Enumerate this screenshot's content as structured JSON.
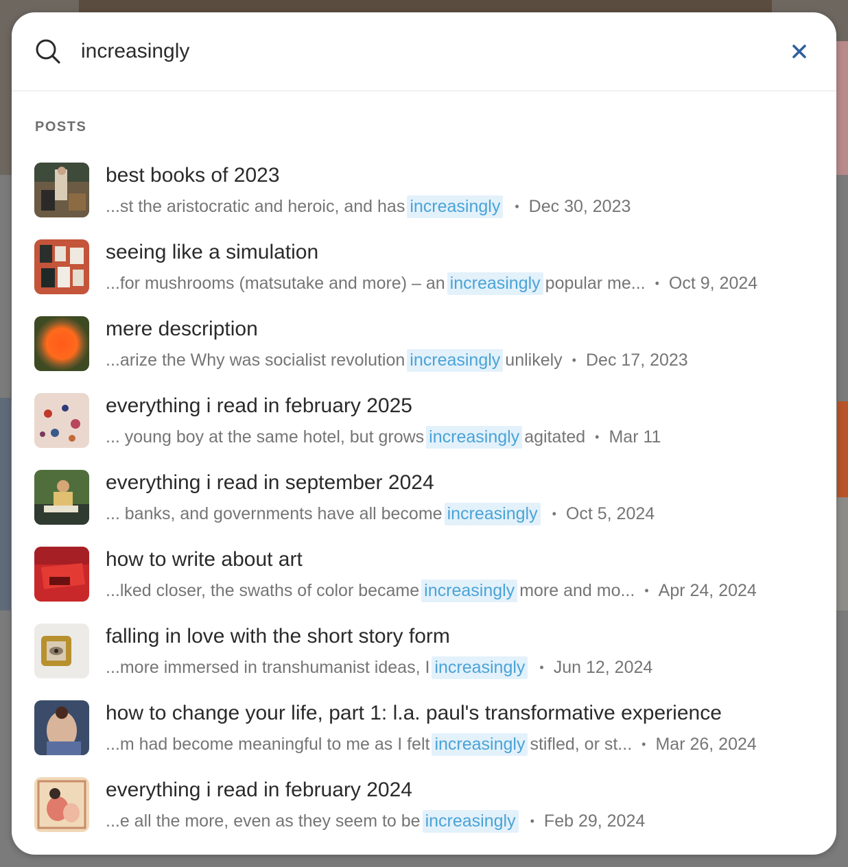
{
  "search": {
    "query": "increasingly"
  },
  "section": {
    "label": "POSTS"
  },
  "results": [
    {
      "title": "best books of 2023",
      "before": "...st the aristocratic and heroic, and has",
      "match": "increasingly",
      "after": "",
      "date": "Dec 30, 2023"
    },
    {
      "title": "seeing like a simulation",
      "before": "...for mushrooms (matsutake and more) – an",
      "match": "increasingly",
      "after": "popular me...",
      "date": "Oct 9, 2024"
    },
    {
      "title": "mere description",
      "before": "...arize the Why was socialist revolution",
      "match": "increasingly",
      "after": "unlikely",
      "date": "Dec 17, 2023"
    },
    {
      "title": "everything i read in february 2025",
      "before": "... young boy at the same hotel, but grows",
      "match": "increasingly",
      "after": "agitated",
      "date": "Mar 11"
    },
    {
      "title": "everything i read in september 2024",
      "before": "... banks, and governments have all become",
      "match": "increasingly",
      "after": "",
      "date": "Oct 5, 2024"
    },
    {
      "title": "how to write about art",
      "before": "...lked closer, the swaths of color became",
      "match": "increasingly",
      "after": "more and mo...",
      "date": "Apr 24, 2024"
    },
    {
      "title": "falling in love with the short story form",
      "before": "...more immersed in transhumanist ideas, I",
      "match": "increasingly",
      "after": "",
      "date": "Jun 12, 2024"
    },
    {
      "title": "how to change your life, part 1: l.a. paul's transformative experience",
      "before": "...m had become meaningful to me as I felt",
      "match": "increasingly",
      "after": "stifled, or st...",
      "date": "Mar 26, 2024"
    },
    {
      "title": "everything i read in february 2024",
      "before": "...e all the more, even as they seem to be",
      "match": "increasingly",
      "after": "",
      "date": "Feb 29, 2024"
    }
  ],
  "colors": {
    "highlight_bg": "#e3f1fb",
    "highlight_text": "#4aa3d6",
    "close_icon": "#2f5f9e"
  },
  "icons": {
    "search": "search-icon",
    "close": "close-icon"
  }
}
